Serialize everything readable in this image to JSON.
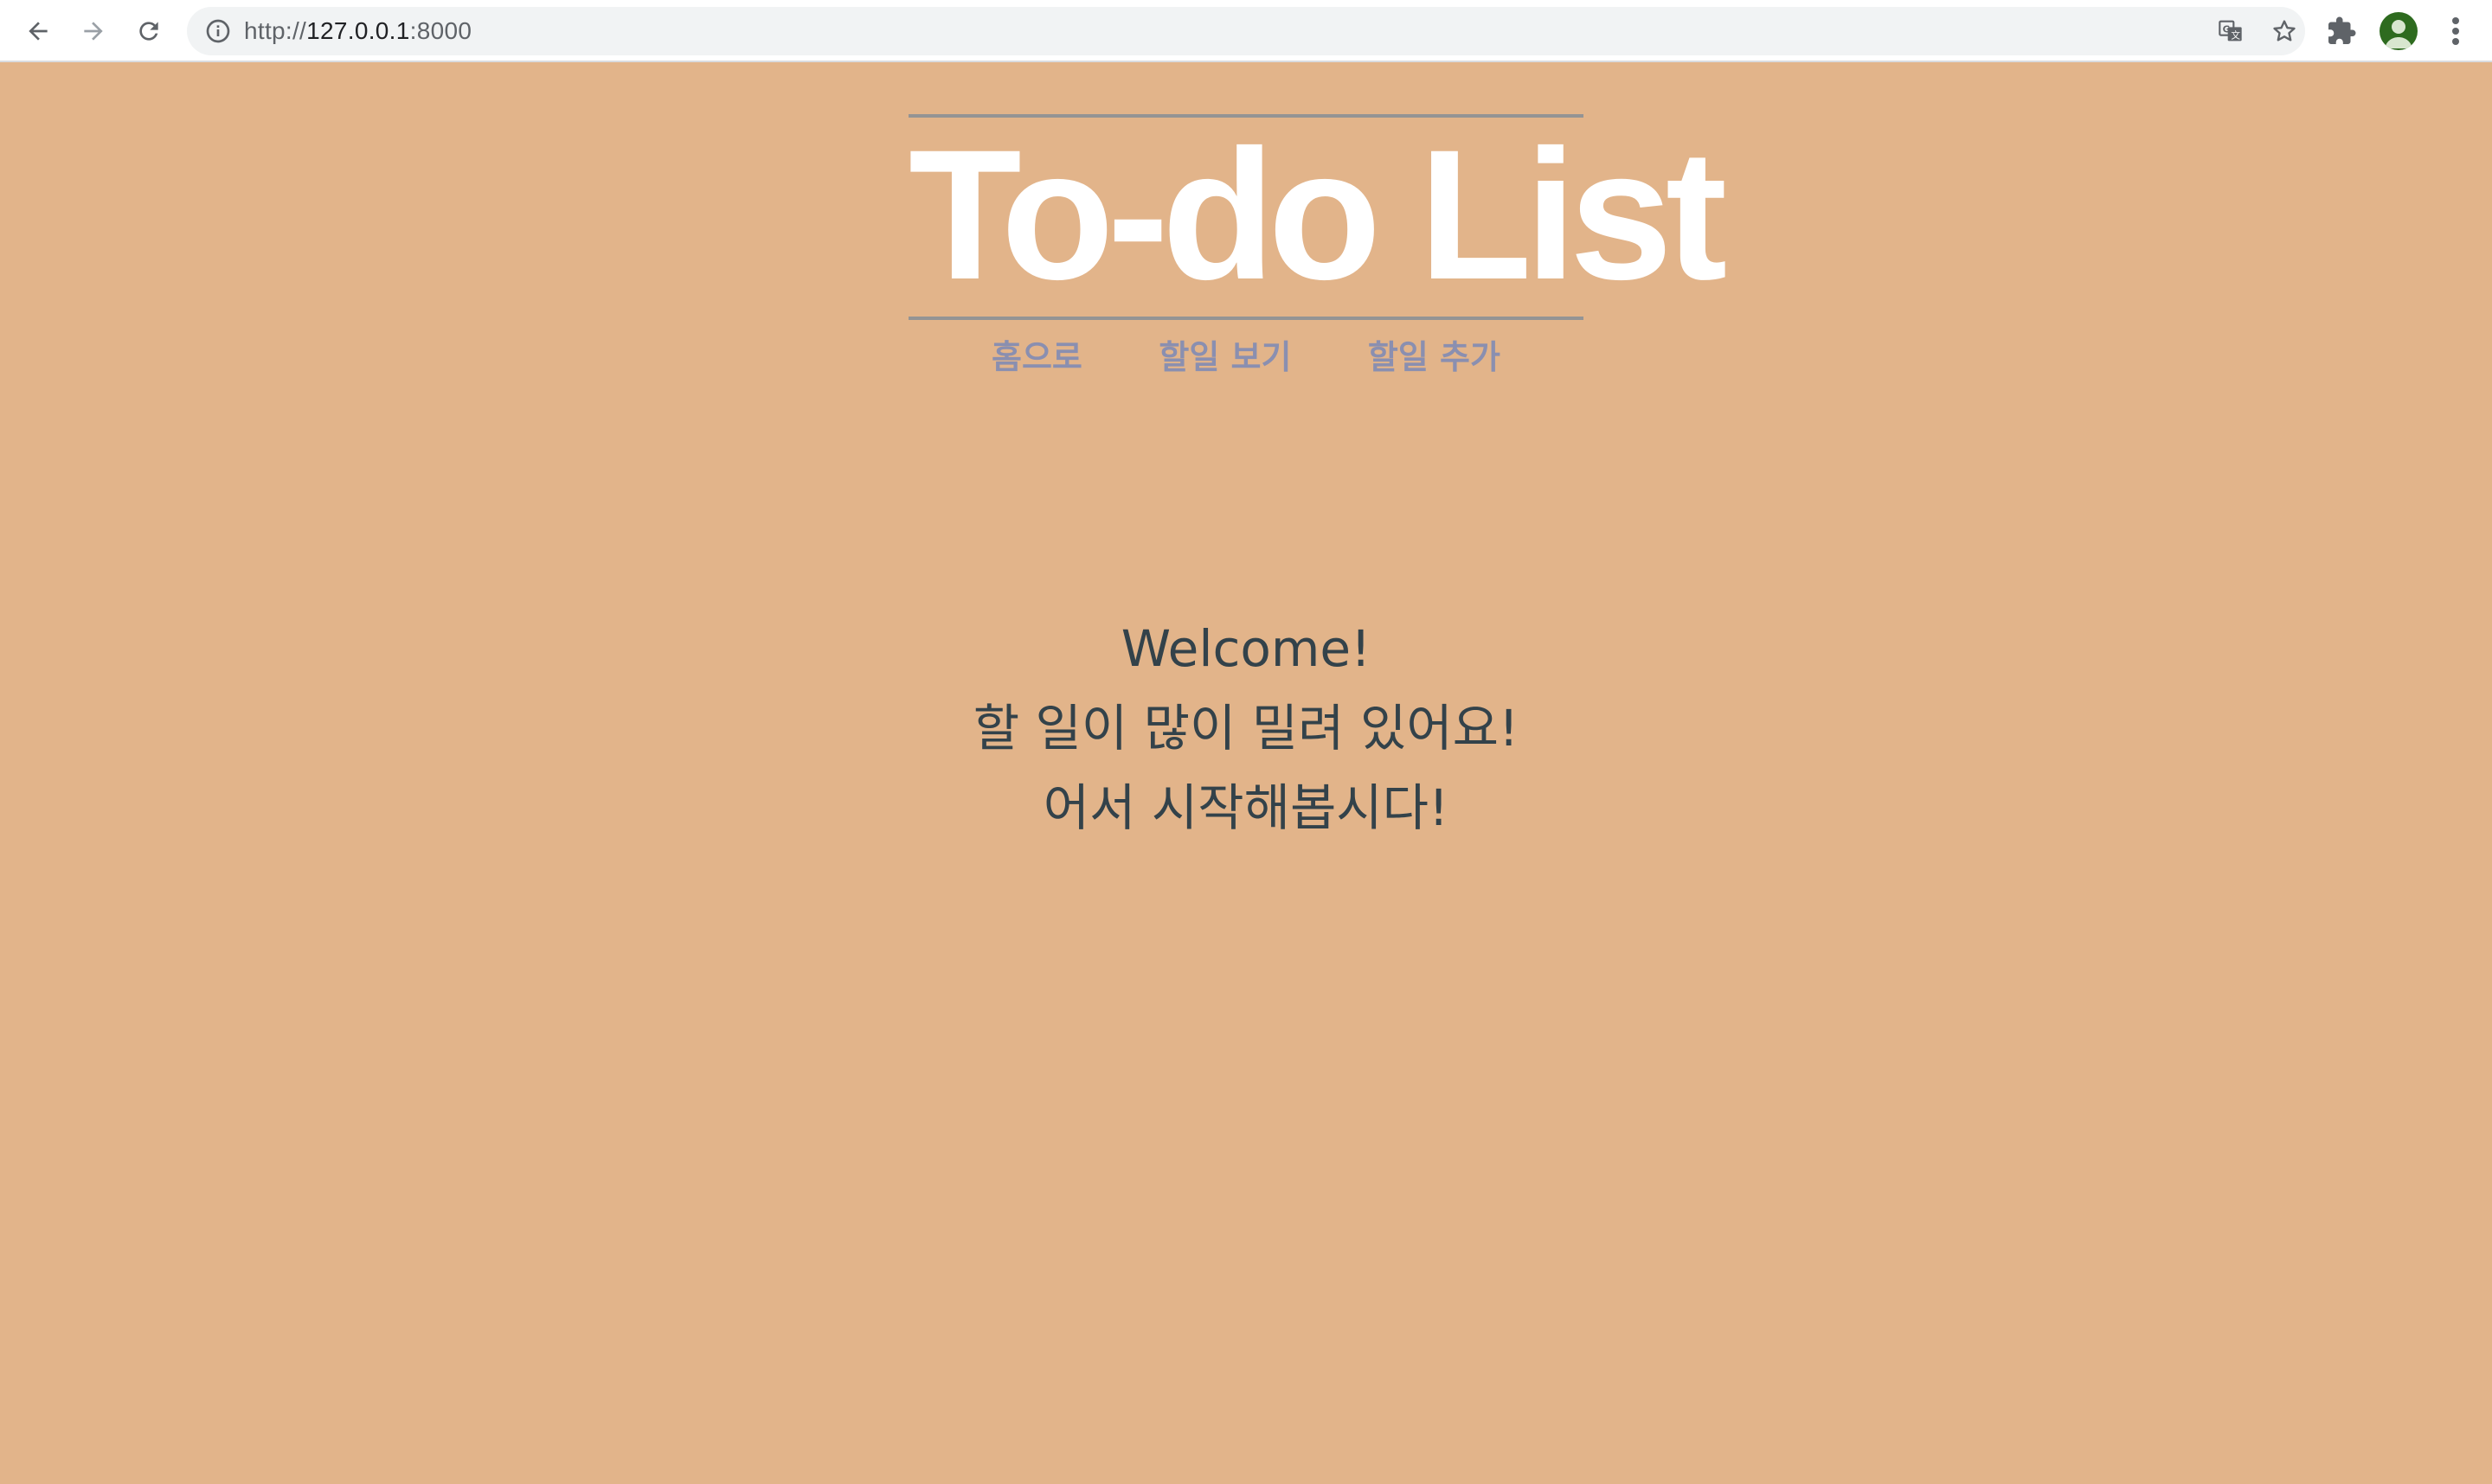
{
  "browser": {
    "url_prefix": "http://",
    "url_host": "127.0.0.1",
    "url_port": ":8000",
    "icons": {
      "back": "back-arrow-icon",
      "forward": "forward-arrow-icon",
      "reload": "reload-icon",
      "site_info": "info-icon",
      "translate": "translate-icon",
      "bookmark": "star-icon",
      "extensions": "puzzle-icon",
      "profile": "avatar",
      "menu": "kebab-menu-icon"
    }
  },
  "page": {
    "title": "To-do List",
    "nav": [
      {
        "label": "홈으로"
      },
      {
        "label": "할일 보기"
      },
      {
        "label": "할일 추가"
      }
    ],
    "welcome_lines": [
      "Welcome!",
      "할 일이 많이 밀려 있어요!",
      "어서 시작해봅시다!"
    ]
  },
  "colors": {
    "background": "#e2b48a",
    "title": "#ffffff",
    "rule": "#949494",
    "nav_link": "#8a8fb0",
    "body_text": "#33424a"
  }
}
